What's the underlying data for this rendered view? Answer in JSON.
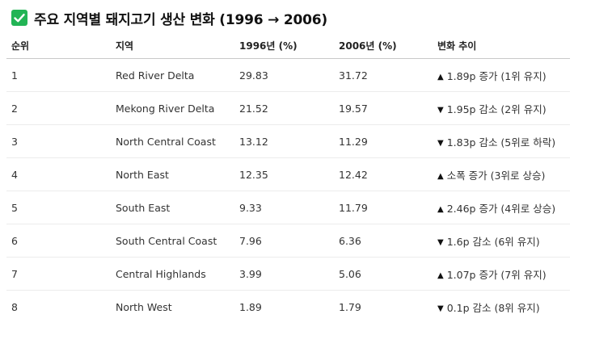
{
  "title": "주요 지역별 돼지고기 생산 변화 (1996 → 2006)",
  "icon": {
    "name": "check-icon",
    "color": "#22b455"
  },
  "table": {
    "headers": [
      "순위",
      "지역",
      "1996년 (%)",
      "2006년 (%)",
      "변화 추이"
    ],
    "rows": [
      {
        "rank": "1",
        "region": "Red River Delta",
        "y1996": "29.83",
        "y2006": "31.72",
        "arrow": "▲",
        "trend": "1.89p 증가 (1위 유지)"
      },
      {
        "rank": "2",
        "region": "Mekong River Delta",
        "y1996": "21.52",
        "y2006": "19.57",
        "arrow": "▼",
        "trend": "1.95p 감소 (2위 유지)"
      },
      {
        "rank": "3",
        "region": "North Central Coast",
        "y1996": "13.12",
        "y2006": "11.29",
        "arrow": "▼",
        "trend": "1.83p 감소 (5위로 하락)"
      },
      {
        "rank": "4",
        "region": "North East",
        "y1996": "12.35",
        "y2006": "12.42",
        "arrow": "▲",
        "trend": "소폭 증가 (3위로 상승)"
      },
      {
        "rank": "5",
        "region": "South East",
        "y1996": "9.33",
        "y2006": "11.79",
        "arrow": "▲",
        "trend": "2.46p 증가 (4위로 상승)"
      },
      {
        "rank": "6",
        "region": "South Central Coast",
        "y1996": "7.96",
        "y2006": "6.36",
        "arrow": "▼",
        "trend": "1.6p 감소 (6위 유지)"
      },
      {
        "rank": "7",
        "region": "Central Highlands",
        "y1996": "3.99",
        "y2006": "5.06",
        "arrow": "▲",
        "trend": "1.07p 증가 (7위 유지)"
      },
      {
        "rank": "8",
        "region": "North West",
        "y1996": "1.89",
        "y2006": "1.79",
        "arrow": "▼",
        "trend": "0.1p 감소 (8위 유지)"
      }
    ]
  }
}
